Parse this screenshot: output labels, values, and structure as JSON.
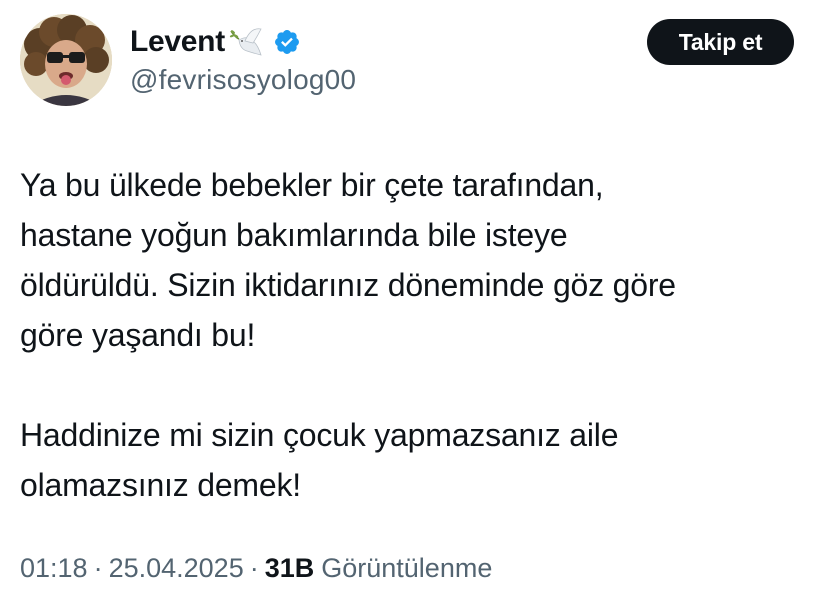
{
  "user": {
    "display_name": "Levent",
    "handle": "@fevrisosyolog00",
    "badges": [
      "dove-icon",
      "verified-icon"
    ],
    "verified_color": "#1d9bf0"
  },
  "follow_button": {
    "label": "Takip et"
  },
  "tweet": {
    "lines_p1": [
      "Ya bu ülkede bebekler bir çete tarafından,",
      "hastane yoğun bakımlarında bile isteye",
      "öldürüldü. Sizin iktidarınız döneminde göz göre",
      "göre yaşandı bu!"
    ],
    "lines_p2": [
      "Haddinize mi sizin çocuk yapmazsanız aile",
      "olamazsınız demek!"
    ]
  },
  "meta": {
    "time": "01:18",
    "separator": "·",
    "date": "25.04.2025",
    "views_count": "31B",
    "views_label": "Görüntülenme"
  },
  "colors": {
    "text": "#0f1419",
    "secondary": "#536471",
    "button_bg": "#0f1419"
  }
}
